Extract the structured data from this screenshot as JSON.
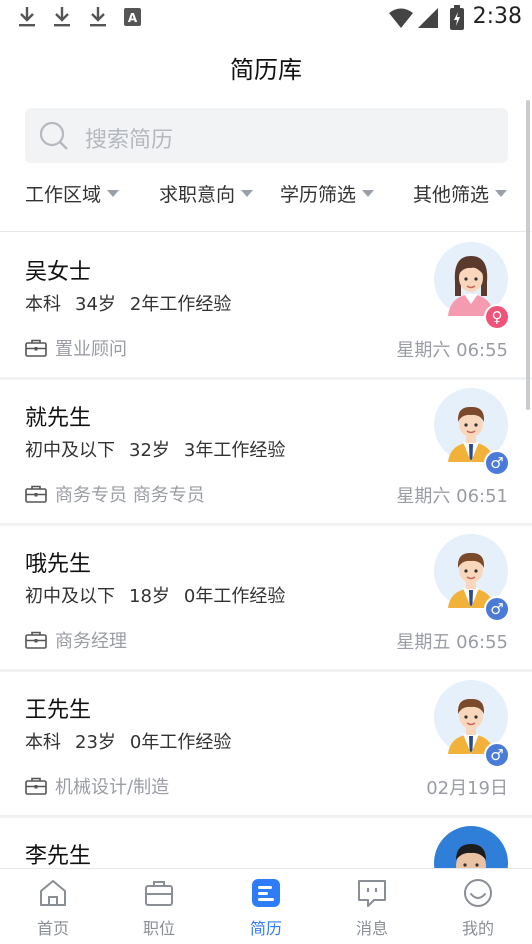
{
  "status_bar": {
    "time": "2:38",
    "left_icons": [
      "download-icon",
      "download-icon",
      "download-icon",
      "font-a-icon"
    ],
    "right_icons": [
      "wifi-icon",
      "signal-icon",
      "battery-icon"
    ]
  },
  "header": {
    "title": "简历库"
  },
  "search": {
    "placeholder": "搜索简历"
  },
  "filters": [
    {
      "label": "工作区域"
    },
    {
      "label": "求职意向"
    },
    {
      "label": "学历筛选"
    },
    {
      "label": "其他筛选"
    }
  ],
  "resumes": [
    {
      "name": "吴女士",
      "education": "本科",
      "age": "34岁",
      "experience": "2年工作经验",
      "position": "置业顾问",
      "time": "星期六 06:55",
      "gender": "female"
    },
    {
      "name": "就先生",
      "education": "初中及以下",
      "age": "32岁",
      "experience": "3年工作经验",
      "position": "商务专员 商务专员",
      "time": "星期六 06:51",
      "gender": "male"
    },
    {
      "name": "哦先生",
      "education": "初中及以下",
      "age": "18岁",
      "experience": "0年工作经验",
      "position": "商务经理",
      "time": "星期五 06:55",
      "gender": "male"
    },
    {
      "name": "王先生",
      "education": "本科",
      "age": "23岁",
      "experience": "0年工作经验",
      "position": "机械设计/制造",
      "time": "02月19日",
      "gender": "male"
    },
    {
      "name": "李先生",
      "gender": "male"
    }
  ],
  "tabs": [
    {
      "label": "首页",
      "icon": "home-icon"
    },
    {
      "label": "职位",
      "icon": "briefcase-icon"
    },
    {
      "label": "简历",
      "icon": "resume-icon",
      "active": true
    },
    {
      "label": "消息",
      "icon": "message-icon"
    },
    {
      "label": "我的",
      "icon": "profile-icon"
    }
  ],
  "colors": {
    "accent": "#2f7df6",
    "female": "#f0527a",
    "male": "#4b7bd8"
  }
}
